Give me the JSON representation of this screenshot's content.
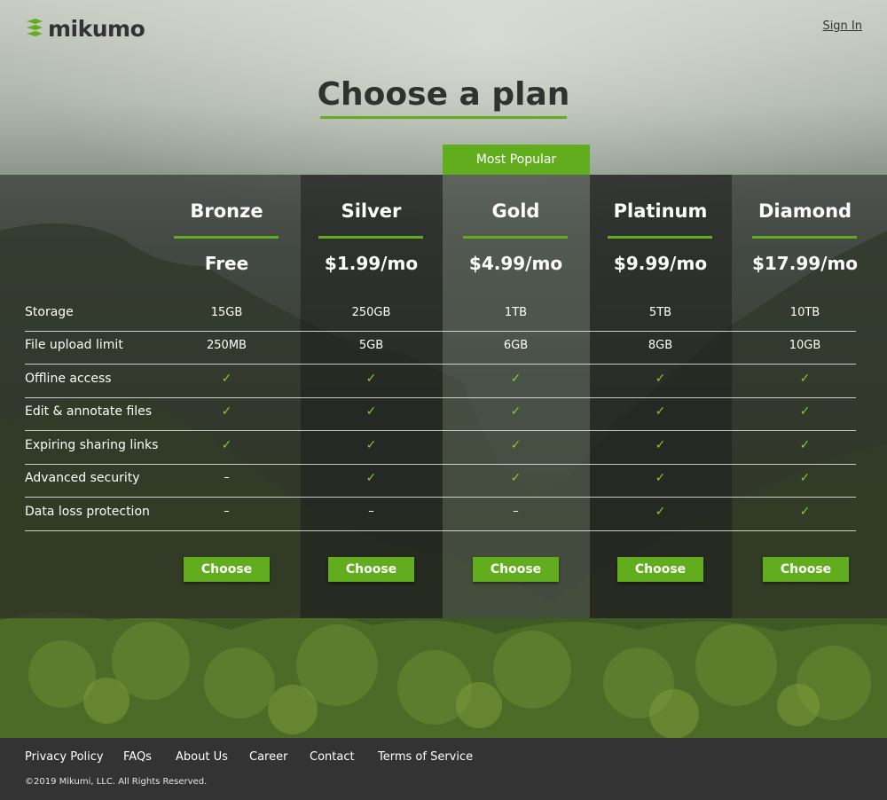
{
  "brand": {
    "name": "mikumo",
    "accent": "#62ad1e"
  },
  "header": {
    "signin_label": "Sign In"
  },
  "page": {
    "title": "Choose a plan",
    "popular_badge": "Most Popular"
  },
  "plans": [
    {
      "name": "Bronze",
      "price": "Free",
      "button": "Choose"
    },
    {
      "name": "Silver",
      "price": "$1.99/mo",
      "button": "Choose"
    },
    {
      "name": "Gold",
      "price": "$4.99/mo",
      "button": "Choose"
    },
    {
      "name": "Platinum",
      "price": "$9.99/mo",
      "button": "Choose"
    },
    {
      "name": "Diamond",
      "price": "$17.99/mo",
      "button": "Choose"
    }
  ],
  "features": [
    {
      "label": "Storage",
      "values": [
        "15GB",
        "250GB",
        "1TB",
        "5TB",
        "10TB"
      ]
    },
    {
      "label": "File upload limit",
      "values": [
        "250MB",
        "5GB",
        "6GB",
        "8GB",
        "10GB"
      ]
    },
    {
      "label": "Offline access",
      "values": [
        "✓",
        "✓",
        "✓",
        "✓",
        "✓"
      ]
    },
    {
      "label": "Edit & annotate files",
      "values": [
        "✓",
        "✓",
        "✓",
        "✓",
        "✓"
      ]
    },
    {
      "label": "Expiring sharing links",
      "values": [
        "✓",
        "✓",
        "✓",
        "✓",
        "✓"
      ]
    },
    {
      "label": "Advanced security",
      "values": [
        "–",
        "✓",
        "✓",
        "✓",
        "✓"
      ]
    },
    {
      "label": "Data loss protection",
      "values": [
        "–",
        "–",
        "–",
        "✓",
        "✓"
      ]
    }
  ],
  "footer": {
    "links": [
      "Privacy Policy",
      "FAQs",
      "About Us",
      "Career",
      "Contact",
      "Terms of Service"
    ],
    "copyright": "©2019 Mikumi, LLC. All Rights Reserved."
  }
}
